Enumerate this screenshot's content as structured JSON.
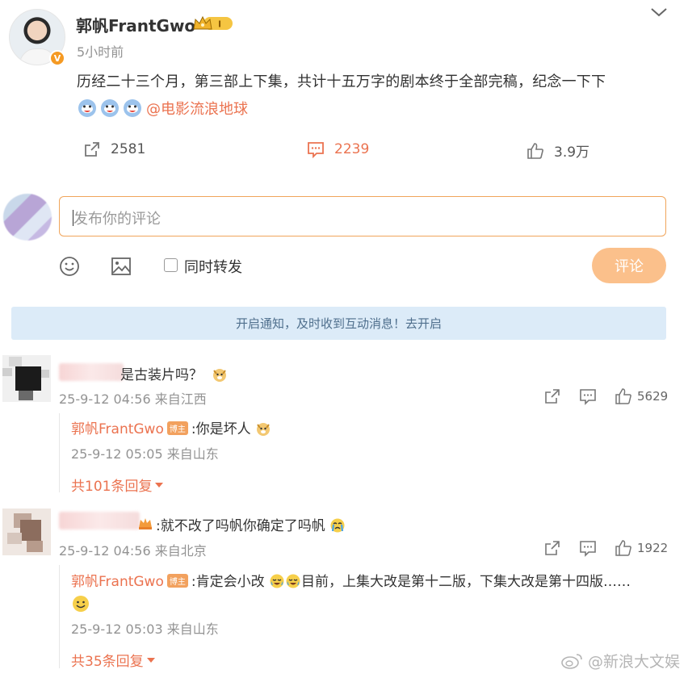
{
  "post": {
    "author": "郭帆FrantGwo",
    "time": "5小时前",
    "text": "历经二十三个月，第三部上下集，共计十五万字的剧本终于全部完稿，纪念一下下",
    "mention": "@电影流浪地球",
    "verified_badge": "V",
    "crown_level": "I",
    "stats": {
      "repost": "2581",
      "comment": "2239",
      "like": "3.9万"
    }
  },
  "composer": {
    "placeholder": "发布你的评论",
    "also_repost_label": "同时转发",
    "submit_label": "评论"
  },
  "notice": "开启通知，及时收到互动消息！去开启",
  "comments": [
    {
      "text": "是古装片吗？",
      "meta": "25-9-12 04:56 来自江西",
      "likes": "5629",
      "reply": {
        "author": "郭帆FrantGwo",
        "tag": "博主",
        "text": ":你是坏人",
        "meta": "25-9-12 05:05 来自山东"
      },
      "more": "共101条回复"
    },
    {
      "text": ":就不改了吗帆你确定了吗帆",
      "meta": "25-9-12 04:56 来自北京",
      "likes": "1922",
      "reply": {
        "author": "郭帆FrantGwo",
        "tag": "博主",
        "text_a": ":肯定会小改",
        "text_b": "目前，上集大改是第十二版，下集大改是第十四版……",
        "meta": "25-9-12 05:03 来自山东"
      },
      "more": "共35条回复"
    }
  ],
  "watermark": "@新浪大文娱",
  "colors": {
    "accent": "#eb7350",
    "button": "#fbc08b",
    "notice_bg": "#dcebf8"
  }
}
